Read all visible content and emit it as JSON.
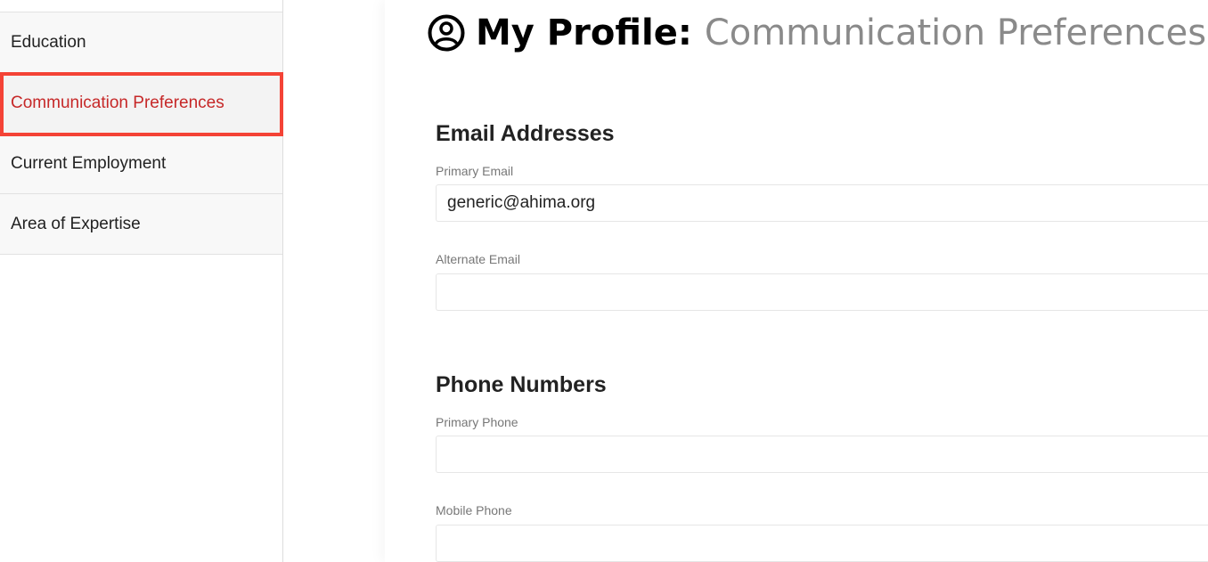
{
  "sidebar": {
    "items": [
      {
        "label": "Education",
        "active": false
      },
      {
        "label": "Communication Preferences",
        "active": true
      },
      {
        "label": "Current Employment",
        "active": false
      },
      {
        "label": "Area of Expertise",
        "active": false
      }
    ]
  },
  "header": {
    "icon": "user-circle-icon",
    "title_prefix": "My Profile:",
    "title_section": "Communication Preferences"
  },
  "email_section": {
    "heading": "Email Addresses",
    "primary": {
      "label": "Primary Email",
      "value": "generic@ahima.org"
    },
    "alternate": {
      "label": "Alternate Email",
      "value": ""
    }
  },
  "phone_section": {
    "heading": "Phone Numbers",
    "primary": {
      "label": "Primary Phone",
      "value": ""
    },
    "mobile": {
      "label": "Mobile Phone",
      "value": ""
    }
  },
  "colors": {
    "active_text": "#c62828",
    "annotation": "#f44336",
    "subtitle_gray": "#8a8a8a"
  }
}
